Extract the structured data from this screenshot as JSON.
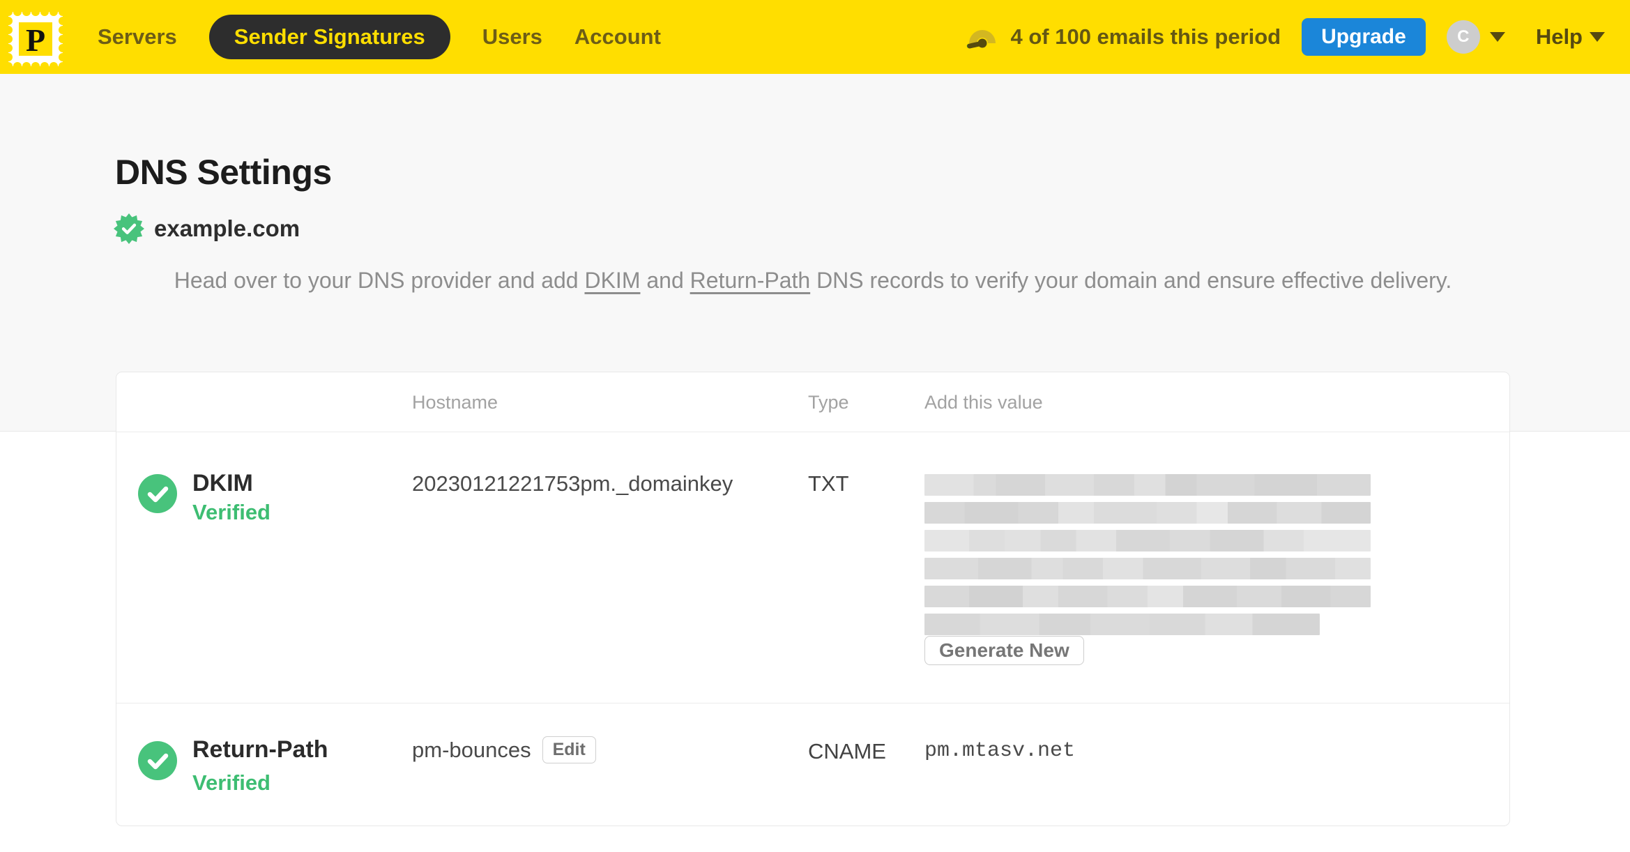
{
  "nav": {
    "logo_letter": "P",
    "items": [
      {
        "label": "Servers",
        "active": false
      },
      {
        "label": "Sender Signatures",
        "active": true
      },
      {
        "label": "Users",
        "active": false
      },
      {
        "label": "Account",
        "active": false
      }
    ],
    "usage_text": "4 of 100 emails this period",
    "upgrade_label": "Upgrade",
    "avatar_initial": "C",
    "help_label": "Help"
  },
  "page": {
    "title": "DNS Settings",
    "domain": "example.com",
    "intro": {
      "part1": "Head over to your DNS provider and add ",
      "link_dkim": "DKIM",
      "part2": " and ",
      "link_return_path": "Return-Path",
      "part3": " DNS records to verify your domain and ensure effective delivery."
    }
  },
  "table": {
    "headers": {
      "hostname": "Hostname",
      "type": "Type",
      "value": "Add this value"
    },
    "rows": [
      {
        "name": "DKIM",
        "status": "Verified",
        "hostname": "20230121221753pm._domainkey",
        "type": "TXT",
        "value_redacted": true,
        "redacted_lines": 6,
        "action_label": "Generate New"
      },
      {
        "name": "Return-Path",
        "status": "Verified",
        "hostname": "pm-bounces",
        "edit_label": "Edit",
        "type": "CNAME",
        "value": "pm.mtasv.net"
      }
    ]
  },
  "colors": {
    "brand_yellow": "#FFDE00",
    "nav_ink": "#6d5d16",
    "active_pill_bg": "#2d2d2d",
    "upgrade_blue": "#1b86d9",
    "success_green": "#48c37c",
    "verified_text_green": "#3dbd72",
    "title_ink": "#1c1c1c",
    "muted_gray": "#8d8d8d",
    "hero_bg": "#f8f8f8"
  }
}
